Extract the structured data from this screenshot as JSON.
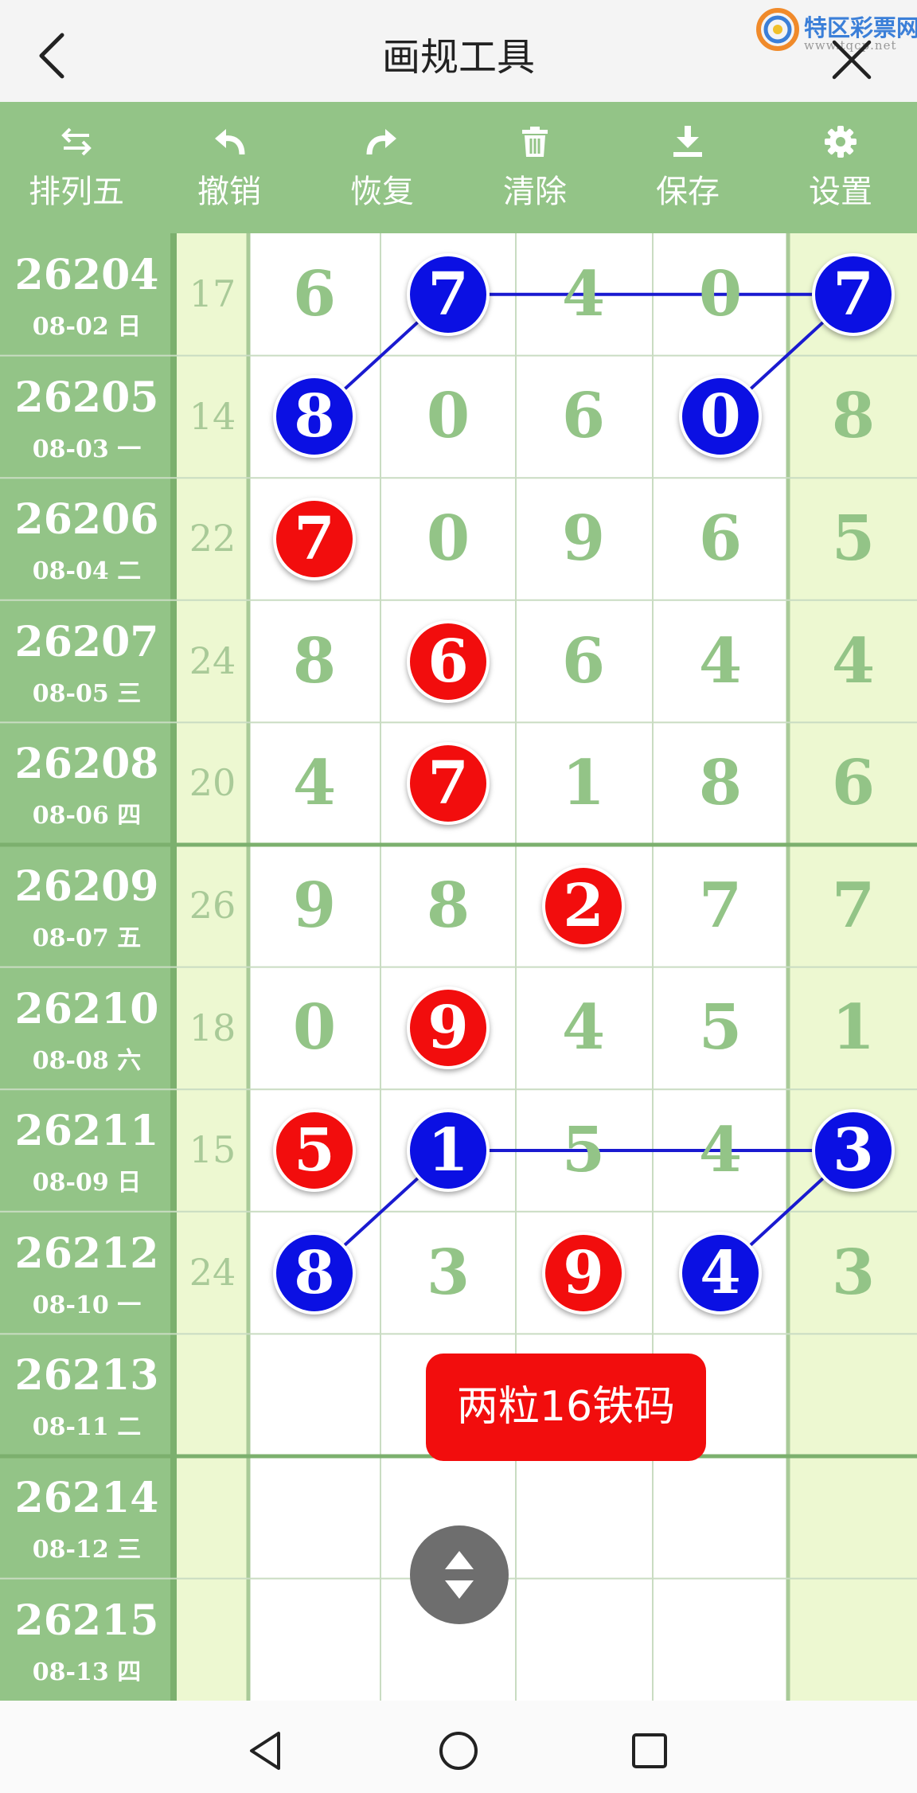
{
  "header": {
    "title": "画规工具",
    "logo_text": "特区彩票网",
    "logo_url": "www.tqcp.net"
  },
  "toolbar": {
    "items": [
      {
        "label": "排列五",
        "icon": "swap-arrows-icon"
      },
      {
        "label": "撤销",
        "icon": "undo-icon"
      },
      {
        "label": "恢复",
        "icon": "redo-icon"
      },
      {
        "label": "清除",
        "icon": "trash-icon"
      },
      {
        "label": "保存",
        "icon": "download-icon"
      },
      {
        "label": "设置",
        "icon": "gear-icon"
      }
    ]
  },
  "colors": {
    "toolbar_bg": "#93c487",
    "digit": "#93c487",
    "highlight_bg": "#edf8d1",
    "ball_red": "#f20d0d",
    "ball_blue": "#0b10e3",
    "line_blue": "#1a1ad0"
  },
  "rows": [
    {
      "issue": "26204",
      "date": "08-02 日",
      "sum": "17",
      "digits": [
        "6",
        "7",
        "4",
        "0",
        "7"
      ],
      "marks": [
        "",
        "blue",
        "",
        "",
        "blue"
      ]
    },
    {
      "issue": "26205",
      "date": "08-03 一",
      "sum": "14",
      "digits": [
        "8",
        "0",
        "6",
        "0",
        "8"
      ],
      "marks": [
        "blue",
        "",
        "",
        "blue",
        ""
      ]
    },
    {
      "issue": "26206",
      "date": "08-04 二",
      "sum": "22",
      "digits": [
        "7",
        "0",
        "9",
        "6",
        "5"
      ],
      "marks": [
        "red",
        "",
        "",
        "",
        ""
      ]
    },
    {
      "issue": "26207",
      "date": "08-05 三",
      "sum": "24",
      "digits": [
        "8",
        "6",
        "6",
        "4",
        "4"
      ],
      "marks": [
        "",
        "red",
        "",
        "",
        ""
      ]
    },
    {
      "issue": "26208",
      "date": "08-06 四",
      "sum": "20",
      "digits": [
        "4",
        "7",
        "1",
        "8",
        "6"
      ],
      "marks": [
        "",
        "red",
        "",
        "",
        ""
      ]
    },
    {
      "issue": "26209",
      "date": "08-07 五",
      "sum": "26",
      "digits": [
        "9",
        "8",
        "2",
        "7",
        "7"
      ],
      "marks": [
        "",
        "",
        "red",
        "",
        ""
      ]
    },
    {
      "issue": "26210",
      "date": "08-08 六",
      "sum": "18",
      "digits": [
        "0",
        "9",
        "4",
        "5",
        "1"
      ],
      "marks": [
        "",
        "red",
        "",
        "",
        ""
      ]
    },
    {
      "issue": "26211",
      "date": "08-09 日",
      "sum": "15",
      "digits": [
        "5",
        "1",
        "5",
        "4",
        "3"
      ],
      "marks": [
        "red",
        "blue",
        "",
        "",
        "blue"
      ]
    },
    {
      "issue": "26212",
      "date": "08-10 一",
      "sum": "24",
      "digits": [
        "8",
        "3",
        "9",
        "4",
        "3"
      ],
      "marks": [
        "blue",
        "",
        "red",
        "blue",
        ""
      ]
    },
    {
      "issue": "26213",
      "date": "08-11 二",
      "sum": "",
      "digits": [
        "",
        "",
        "",
        "",
        ""
      ],
      "marks": [
        "",
        "",
        "",
        "",
        ""
      ]
    },
    {
      "issue": "26214",
      "date": "08-12 三",
      "sum": "",
      "digits": [
        "",
        "",
        "",
        "",
        ""
      ],
      "marks": [
        "",
        "",
        "",
        "",
        ""
      ]
    },
    {
      "issue": "26215",
      "date": "08-13 四",
      "sum": "",
      "digits": [
        "",
        "",
        "",
        "",
        ""
      ],
      "marks": [
        "",
        "",
        "",
        "",
        ""
      ]
    }
  ],
  "connections": [
    {
      "from": [
        0,
        1
      ],
      "to": [
        0,
        4
      ]
    },
    {
      "from": [
        0,
        1
      ],
      "to": [
        1,
        0
      ]
    },
    {
      "from": [
        0,
        4
      ],
      "to": [
        1,
        3
      ]
    },
    {
      "from": [
        7,
        1
      ],
      "to": [
        7,
        4
      ]
    },
    {
      "from": [
        7,
        1
      ],
      "to": [
        8,
        0
      ]
    },
    {
      "from": [
        7,
        4
      ],
      "to": [
        8,
        3
      ]
    }
  ],
  "toast": {
    "text": "两粒16铁码"
  },
  "fab": {
    "icon": "expand-collapse-icon"
  },
  "navbar": {
    "items": [
      {
        "icon": "nav-back-icon"
      },
      {
        "icon": "nav-home-icon"
      },
      {
        "icon": "nav-recents-icon"
      }
    ]
  }
}
